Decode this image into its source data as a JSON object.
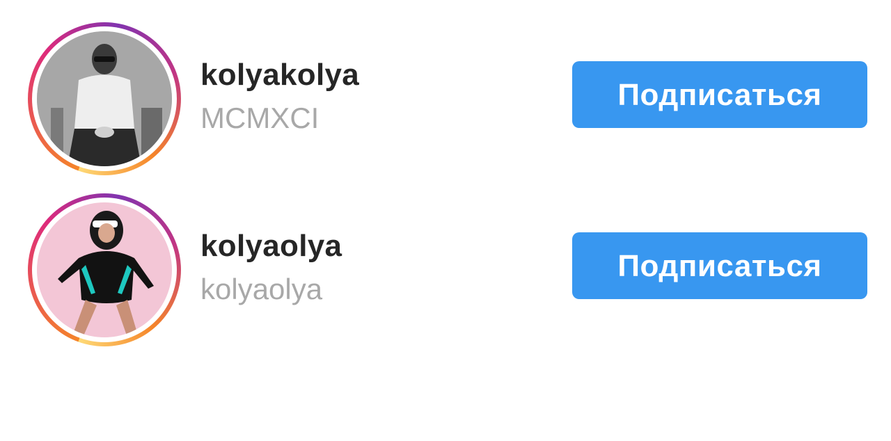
{
  "accounts": [
    {
      "username": "kolyakolya",
      "full_name": "MCMXCI",
      "follow_label": "Подписаться",
      "avatar_icon": "profile-photo-man-sunglasses"
    },
    {
      "username": "kolyaolya",
      "full_name": "kolyaolya",
      "follow_label": "Подписаться",
      "avatar_icon": "profile-photo-woman-swimsuit"
    }
  ],
  "colors": {
    "follow_button": "#3897f0",
    "username_text": "#262626",
    "secondary_text": "#a8a8a8",
    "story_ring_start": "#f58529",
    "story_ring_end": "#8134af"
  }
}
